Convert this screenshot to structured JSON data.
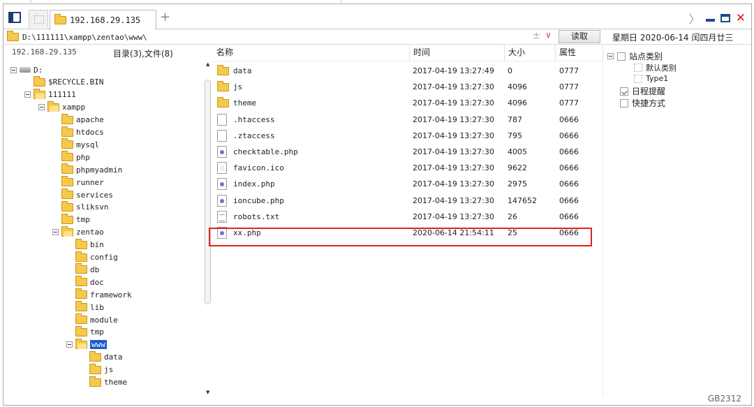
{
  "tabs": {
    "active_label": "192.168.29.135",
    "add_symbol": "+"
  },
  "window_controls": {
    "chevron": "〉",
    "close_symbol": "✕"
  },
  "path_bar": {
    "path": "D:\\111111\\xampp\\zentao\\www\\",
    "plus_symbol": "±",
    "dropdown_symbol": "∨",
    "read_button": "读取",
    "date": "星期日 2020-06-14 闰四月廿三"
  },
  "tree_panel": {
    "host": "192.168.29.135",
    "count": "目录(3),文件(8)",
    "items": [
      {
        "label": "D:",
        "icon": "drive-icon"
      },
      {
        "label": "$RECYCLE.BIN",
        "icon": "folder-icon"
      },
      {
        "label": "111111",
        "icon": "folder-icon"
      },
      {
        "label": "xampp",
        "icon": "folder-icon"
      },
      {
        "label": "apache",
        "icon": "folder-icon"
      },
      {
        "label": "htdocs",
        "icon": "folder-icon"
      },
      {
        "label": "mysql",
        "icon": "folder-icon"
      },
      {
        "label": "php",
        "icon": "folder-icon"
      },
      {
        "label": "phpmyadmin",
        "icon": "folder-icon"
      },
      {
        "label": "runner",
        "icon": "folder-icon"
      },
      {
        "label": "services",
        "icon": "folder-icon"
      },
      {
        "label": "sliksvn",
        "icon": "folder-icon"
      },
      {
        "label": "tmp",
        "icon": "folder-icon"
      },
      {
        "label": "zentao",
        "icon": "folder-icon"
      },
      {
        "label": "bin",
        "icon": "folder-icon"
      },
      {
        "label": "config",
        "icon": "folder-icon"
      },
      {
        "label": "db",
        "icon": "folder-icon"
      },
      {
        "label": "doc",
        "icon": "folder-icon"
      },
      {
        "label": "framework",
        "icon": "folder-icon"
      },
      {
        "label": "lib",
        "icon": "folder-icon"
      },
      {
        "label": "module",
        "icon": "folder-icon"
      },
      {
        "label": "tmp",
        "icon": "folder-icon"
      },
      {
        "label": "www",
        "icon": "folder-icon",
        "selected": true
      },
      {
        "label": "data",
        "icon": "folder-icon"
      },
      {
        "label": "js",
        "icon": "folder-icon"
      },
      {
        "label": "theme",
        "icon": "folder-icon"
      }
    ]
  },
  "file_list": {
    "columns": {
      "name": "名称",
      "time": "时间",
      "size": "大小",
      "attr": "属性"
    },
    "rows": [
      {
        "name": "data",
        "time": "2017-04-19 13:27:49",
        "size": "0",
        "attr": "0777",
        "type": "folder"
      },
      {
        "name": "js",
        "time": "2017-04-19 13:27:30",
        "size": "4096",
        "attr": "0777",
        "type": "folder"
      },
      {
        "name": "theme",
        "time": "2017-04-19 13:27:30",
        "size": "4096",
        "attr": "0777",
        "type": "folder"
      },
      {
        "name": ".htaccess",
        "time": "2017-04-19 13:27:30",
        "size": "787",
        "attr": "0666",
        "type": "file"
      },
      {
        "name": ".ztaccess",
        "time": "2017-04-19 13:27:30",
        "size": "795",
        "attr": "0666",
        "type": "file"
      },
      {
        "name": "checktable.php",
        "time": "2017-04-19 13:27:30",
        "size": "4005",
        "attr": "0666",
        "type": "php"
      },
      {
        "name": "favicon.ico",
        "time": "2017-04-19 13:27:30",
        "size": "9622",
        "attr": "0666",
        "type": "ico"
      },
      {
        "name": "index.php",
        "time": "2017-04-19 13:27:30",
        "size": "2975",
        "attr": "0666",
        "type": "php"
      },
      {
        "name": "ioncube.php",
        "time": "2017-04-19 13:27:30",
        "size": "147652",
        "attr": "0666",
        "type": "php"
      },
      {
        "name": "robots.txt",
        "time": "2017-04-19 13:27:30",
        "size": "26",
        "attr": "0666",
        "type": "txt"
      },
      {
        "name": "xx.php",
        "time": "2020-06-14 21:54:11",
        "size": "25",
        "attr": "0666",
        "type": "php",
        "highlighted": true
      }
    ]
  },
  "right_panel": {
    "items": [
      {
        "label": "站点类别",
        "icon": "list-icon"
      },
      {
        "label": "默认类别",
        "icon": "category-icon"
      },
      {
        "label": "Type1",
        "icon": "category-icon"
      },
      {
        "label": "日程提醒",
        "icon": "calendar-icon"
      },
      {
        "label": "快捷方式",
        "icon": "shortcut-icon"
      }
    ]
  },
  "status": {
    "encoding": "GB2312"
  },
  "colors": {
    "selection": "#1f5ccc",
    "highlight_border": "#e02222",
    "folder": "#f6c94a"
  }
}
